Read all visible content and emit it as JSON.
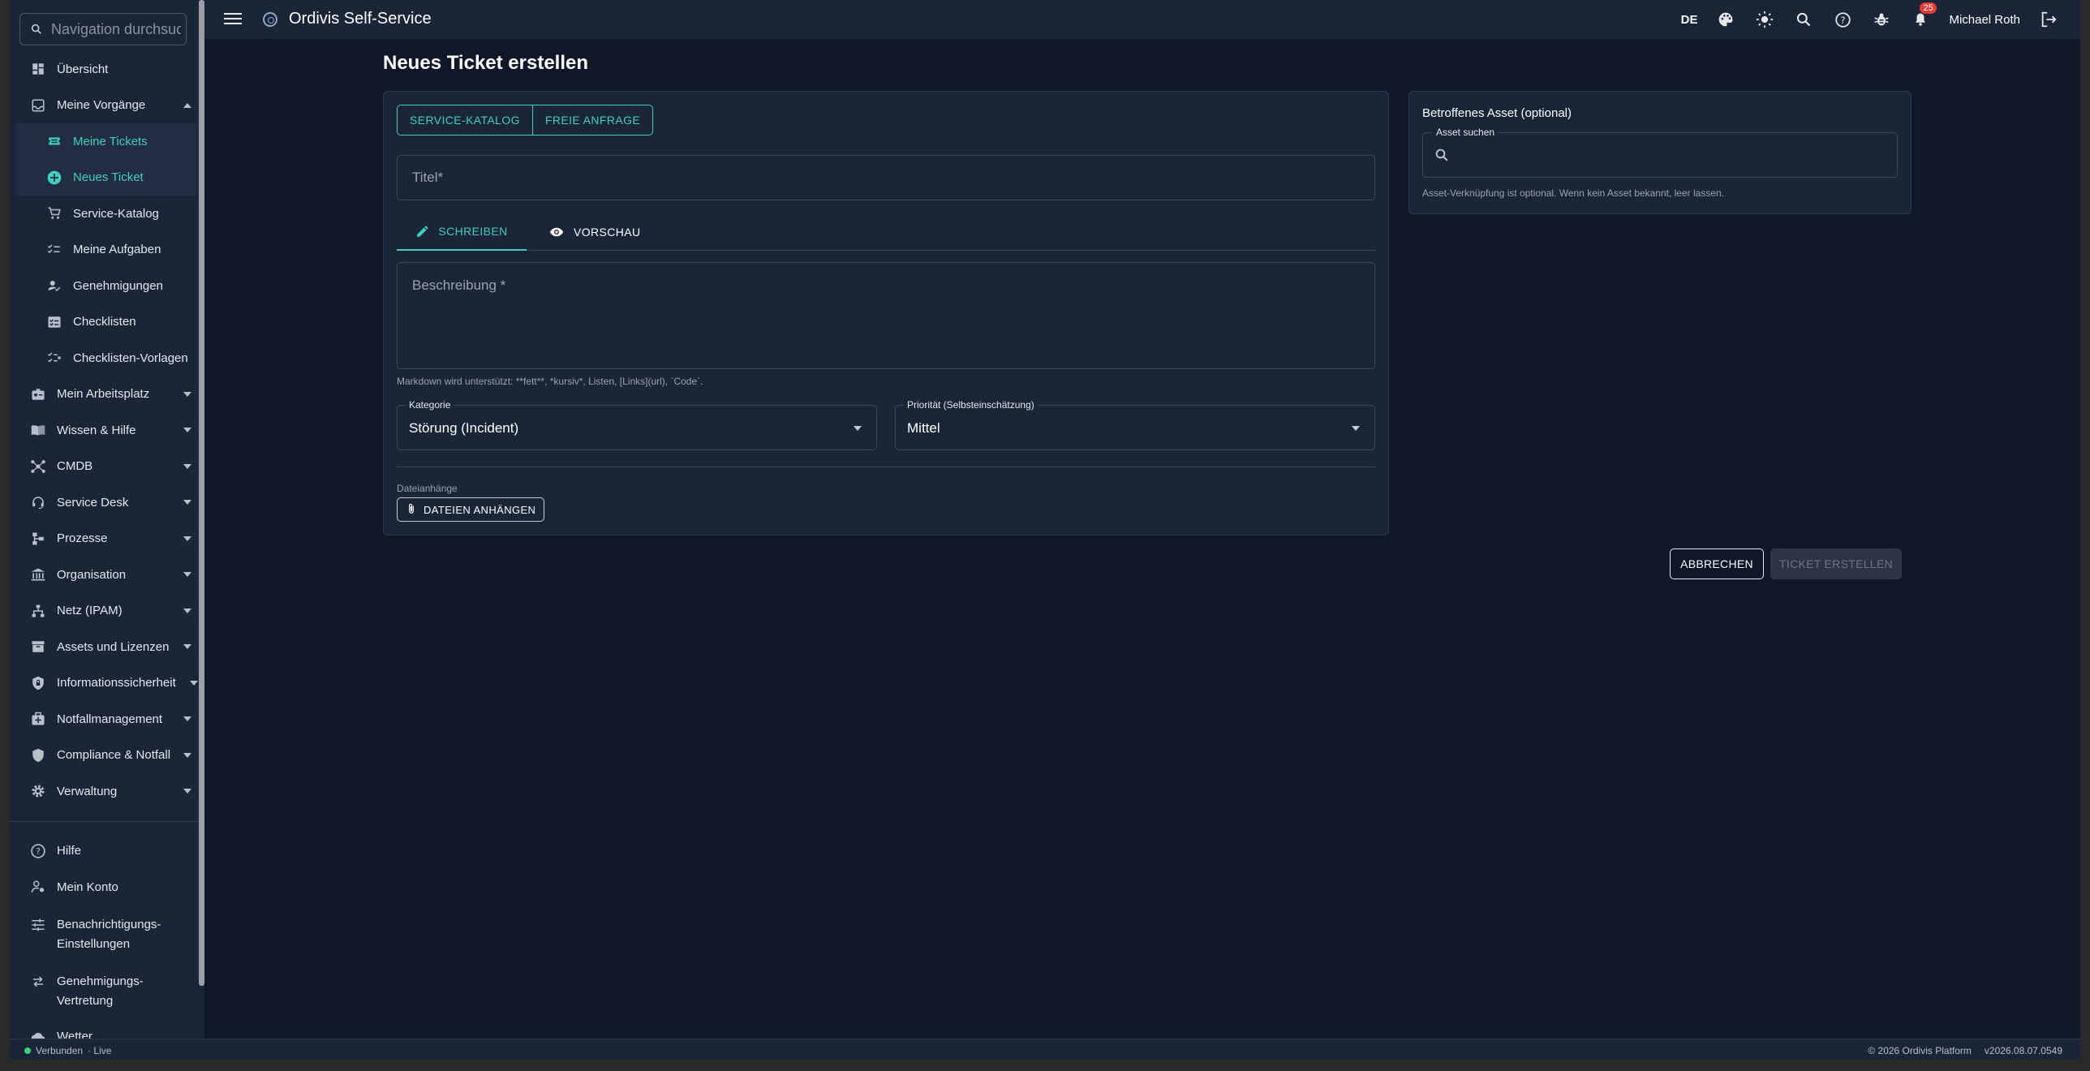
{
  "sidebar": {
    "search_placeholder": "Navigation durchsuchen",
    "items": [
      {
        "label": "Übersicht",
        "icon": "dashboard-icon"
      },
      {
        "label": "Meine Vorgänge",
        "icon": "inbox-icon"
      },
      {
        "label": "Meine Tickets",
        "icon": "ticket-icon"
      },
      {
        "label": "Neues Ticket",
        "icon": "add-circle-icon"
      },
      {
        "label": "Service-Katalog",
        "icon": "cart-icon"
      },
      {
        "label": "Meine Aufgaben",
        "icon": "checklist-icon"
      },
      {
        "label": "Genehmigungen",
        "icon": "approval-icon"
      },
      {
        "label": "Checklisten",
        "icon": "checkbox-list-icon"
      },
      {
        "label": "Checklisten-Vorlagen",
        "icon": "checklist-template-icon"
      },
      {
        "label": "Mein Arbeitsplatz",
        "icon": "badge-icon"
      },
      {
        "label": "Wissen & Hilfe",
        "icon": "book-icon"
      },
      {
        "label": "CMDB",
        "icon": "hub-icon"
      },
      {
        "label": "Service Desk",
        "icon": "headset-icon"
      },
      {
        "label": "Prozesse",
        "icon": "process-icon"
      },
      {
        "label": "Organisation",
        "icon": "bank-icon"
      },
      {
        "label": "Netz (IPAM)",
        "icon": "network-icon"
      },
      {
        "label": "Assets und Lizenzen",
        "icon": "archive-icon"
      },
      {
        "label": "Informationssicherheit",
        "icon": "shield-lock-icon"
      },
      {
        "label": "Notfallmanagement",
        "icon": "medical-bag-icon"
      },
      {
        "label": "Compliance & Notfall",
        "icon": "shield-icon"
      },
      {
        "label": "Verwaltung",
        "icon": "gear-icon"
      },
      {
        "label": "Hilfe",
        "icon": "help-icon"
      },
      {
        "label": "Mein Konto",
        "icon": "account-gear-icon"
      },
      {
        "label": "Benachrichtigungs-",
        "label2": "Einstellungen",
        "icon": "tune-icon"
      },
      {
        "label": "Genehmigungs-",
        "label2": "Vertretung",
        "icon": "swap-icon"
      },
      {
        "label": "Wetter",
        "icon": "cloud-icon"
      }
    ]
  },
  "topbar": {
    "title": "Ordivis Self-Service",
    "lang": "DE",
    "notification_count": "25",
    "user": "Michael Roth"
  },
  "main": {
    "page_title": "Neues Ticket erstellen",
    "mode_tabs": [
      "SERVICE-KATALOG",
      "FREIE ANFRAGE"
    ],
    "title_placeholder": "Titel*",
    "editor_tabs": [
      "SCHREIBEN",
      "VORSCHAU"
    ],
    "desc_placeholder": "Beschreibung *",
    "markdown_hint": "Markdown wird unterstützt: **fett**, *kursiv*, Listen, [Links](url), `Code`.",
    "category_label": "Kategorie",
    "category_value": "Störung (Incident)",
    "priority_label": "Priorität (Selbsteinschätzung)",
    "priority_value": "Mittel",
    "attachments_label": "Dateianhänge",
    "attach_button": "DATEIEN ANHÄNGEN",
    "cancel_button": "ABBRECHEN",
    "submit_button": "TICKET ERSTELLEN"
  },
  "asset": {
    "title": "Betroffenes Asset (optional)",
    "search_label": "Asset suchen",
    "hint": "Asset-Verknüpfung ist optional. Wenn kein Asset bekannt, leer lassen."
  },
  "footer": {
    "status": "Verbunden",
    "live": "· Live",
    "copyright": "© 2026 Ordivis Platform",
    "version": "v2026.08.07.0549"
  },
  "colors": {
    "accent": "#3ecfc0",
    "background": "#0f1729",
    "panel": "#1b2538",
    "badge": "#e53935"
  }
}
